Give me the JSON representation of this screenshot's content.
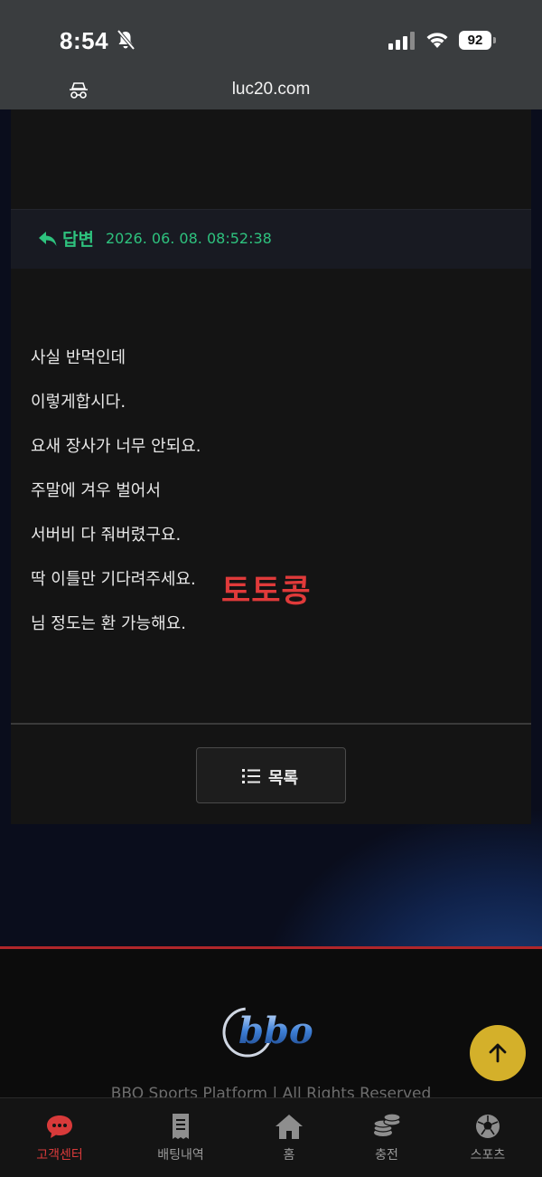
{
  "status_bar": {
    "time": "8:54",
    "battery": "92"
  },
  "browser": {
    "url": "luc20.com"
  },
  "answer": {
    "label": "답변",
    "date": "2026. 06. 08. 08:52:38",
    "lines": [
      "사실 반먹인데",
      "이렇게합시다.",
      "요새 장사가 너무 안되요.",
      "주말에 겨우 벌어서",
      "서버비 다 줘버렸구요.",
      "딱 이틀만 기다려주세요.",
      "님 정도는 환 가능해요."
    ],
    "watermark": "토토콩",
    "list_button": "목록"
  },
  "footer": {
    "copyright": "BBO Sports Platform | All Rights Reserved"
  },
  "bottom_nav": {
    "items": [
      {
        "label": "고객센터",
        "icon": "chat-icon"
      },
      {
        "label": "배팅내역",
        "icon": "receipt-icon"
      },
      {
        "label": "홈",
        "icon": "home-icon"
      },
      {
        "label": "충전",
        "icon": "coins-icon"
      },
      {
        "label": "스포츠",
        "icon": "soccer-ball-icon"
      }
    ]
  },
  "colors": {
    "accent_green": "#2ec27e",
    "accent_red": "#d83a3a",
    "scroll_top": "#d4b02a"
  }
}
